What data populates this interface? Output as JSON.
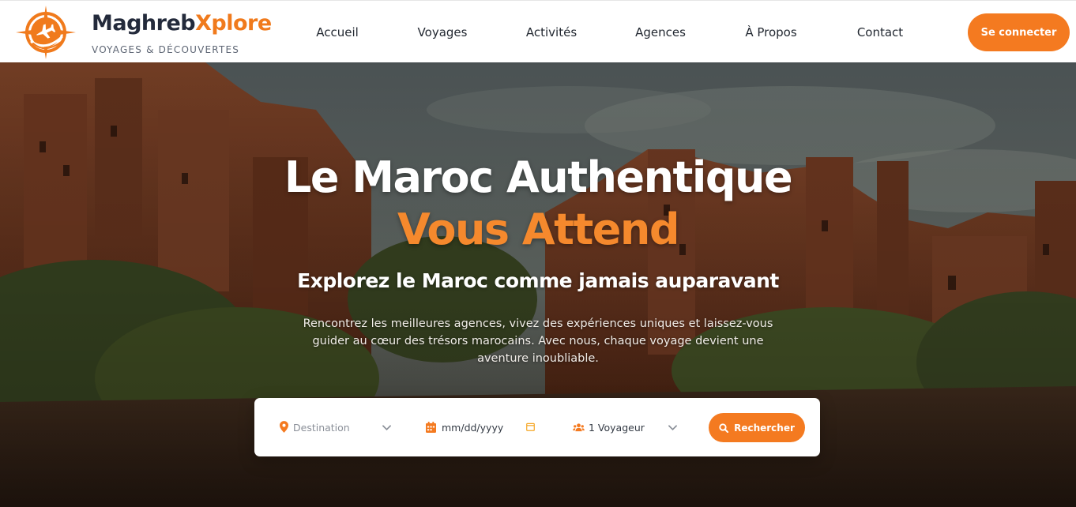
{
  "brand": {
    "name_main": "Maghreb",
    "name_accent": "Xplore",
    "tagline": "VOYAGES & DÉCOUVERTES"
  },
  "nav": {
    "items": [
      {
        "label": "Accueil"
      },
      {
        "label": "Voyages"
      },
      {
        "label": "Activités"
      },
      {
        "label": "Agences"
      },
      {
        "label": "À Propos"
      },
      {
        "label": "Contact"
      }
    ],
    "login_label": "Se connecter"
  },
  "hero": {
    "title_line1": "Le Maroc Authentique",
    "title_line2": "Vous Attend",
    "subtitle": "Explorez le Maroc comme jamais auparavant",
    "description": "Rencontrez les meilleures agences, vivez des expériences uniques et laissez-vous guider au cœur des trésors marocains. Avec nous, chaque voyage devient une aventure inoubliable."
  },
  "search": {
    "destination_placeholder": "Destination",
    "date_placeholder": "mm/dd/yyyy",
    "travelers_value": "1 Voyageur",
    "button_label": "Rechercher",
    "icons": {
      "destination": "map-pin-icon",
      "date": "calendar-icon",
      "travelers": "users-icon",
      "button": "search-icon"
    }
  },
  "colors": {
    "accent": "#f47a20",
    "brand_dark": "#232a3b",
    "title_accent": "#f5892d"
  }
}
